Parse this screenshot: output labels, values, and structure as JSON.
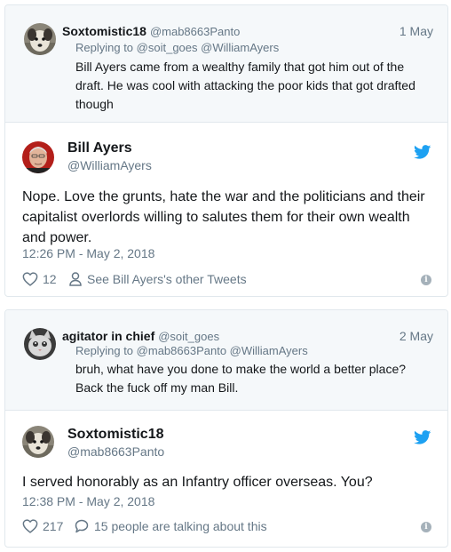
{
  "tweet1": {
    "parent": {
      "name": "Soxtomistic18",
      "handle": "@mab8663Panto",
      "date": "1 May",
      "reply_prefix": "Replying to",
      "reply_to": "@soit_goes @WilliamAyers",
      "text": "Bill Ayers came from a wealthy family that got him out of the draft. He was cool with attacking the poor kids that got drafted though"
    },
    "main": {
      "name": "Bill Ayers",
      "handle": "@WilliamAyers",
      "text": "Nope. Love the grunts, hate the war and the politicians and their capitalist overlords willing to salutes them for their own wealth and power.",
      "time": "12:26 PM - May 2, 2018",
      "likes": "12",
      "other_link": "See Bill Ayers's other Tweets"
    }
  },
  "tweet2": {
    "parent": {
      "name": "agitator in chief",
      "handle": "@soit_goes",
      "date": "2 May",
      "reply_prefix": "Replying to",
      "reply_to": "@mab8663Panto @WilliamAyers",
      "text": "bruh, what have you done to make the world a better place? Back the fuck off my man Bill."
    },
    "main": {
      "name": "Soxtomistic18",
      "handle": "@mab8663Panto",
      "text": "I served honorably as an Infantry officer overseas. You?",
      "time": "12:38 PM - May 2, 2018",
      "likes": "217",
      "talking": "15 people are talking about this"
    }
  },
  "colors": {
    "twitter_blue": "#1da1f2",
    "muted": "#657786",
    "text": "#14171a",
    "parent_bg": "#f5f8fa",
    "border": "#e1e8ed"
  },
  "icons": [
    "twitter-bird-icon",
    "heart-icon",
    "person-icon",
    "speech-bubble-icon",
    "info-icon"
  ]
}
